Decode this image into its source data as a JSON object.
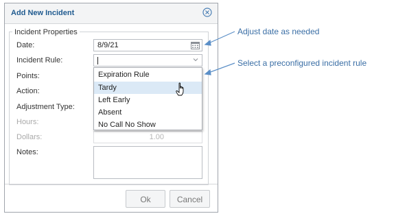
{
  "dialog": {
    "title": "Add New Incident",
    "close_icon": "close-circle-icon",
    "section_legend": "Incident Properties",
    "fields": {
      "date_label": "Date:",
      "date_value": "8/9/21",
      "incident_rule_label": "Incident Rule:",
      "points_label": "Points:",
      "action_label": "Action:",
      "adjustment_type_label": "Adjustment Type:",
      "hours_label": "Hours:",
      "dollars_label": "Dollars:",
      "dollars_value": "1.00",
      "notes_label": "Notes:"
    },
    "dropdown": {
      "options": [
        "Expiration Rule",
        "Tardy",
        "Left Early",
        "Absent",
        "No Call No Show"
      ],
      "hovered": "Tardy"
    },
    "buttons": {
      "ok": "Ok",
      "cancel": "Cancel"
    }
  },
  "annotations": {
    "date_hint": "Adjust date as needed",
    "rule_hint": "Select a preconfigured incident rule"
  },
  "colors": {
    "title": "#1f5a8f",
    "annotation": "#3a6ea5",
    "hover": "#dbe9f6"
  }
}
